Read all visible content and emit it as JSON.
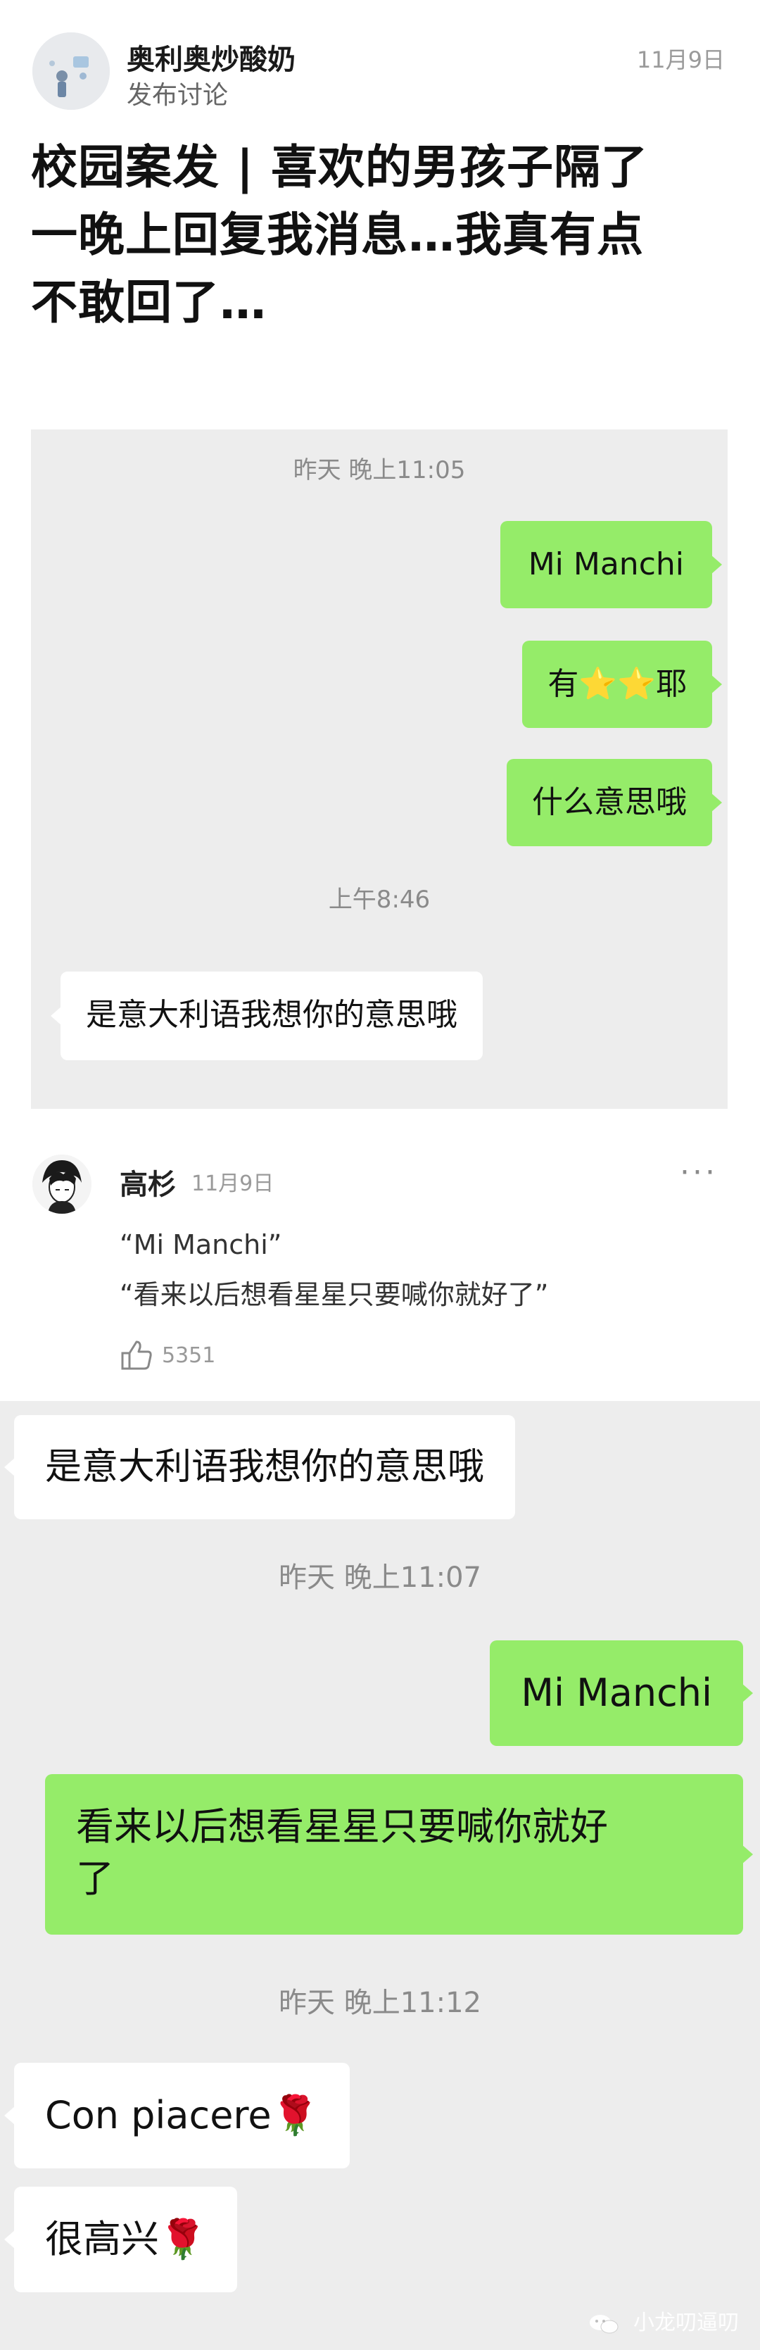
{
  "post": {
    "author": "奥利奥炒酸奶",
    "action": "发布讨论",
    "date": "11月9日",
    "title_line1": "校园案发 | 喜欢的男孩子隔了",
    "title_line2": "一晚上回复我消息…我真有点",
    "title_line3": "不敢回了…"
  },
  "chat1": {
    "ts1": "昨天 晚上11:05",
    "msg1": "Mi Manchi",
    "msg2": "有⭐⭐耶",
    "msg3": "什么意思哦",
    "ts2": "上午8:46",
    "msg4": "是意大利语我想你的意思哦"
  },
  "comment": {
    "name": "高杉",
    "date": "11月9日",
    "more": "···",
    "line1": "“Mi Manchi”",
    "line2": "“看来以后想看星星只要喊你就好了”",
    "likes": "5351"
  },
  "chat2": {
    "msg1": "是意大利语我想你的意思哦",
    "ts1": "昨天 晚上11:07",
    "msg2": "Mi Manchi",
    "msg3_line1": "看来以后想看星星只要喊你就好",
    "msg3_line2": "了",
    "ts2": "昨天 晚上11:12",
    "msg4": "Con piacere🌹",
    "msg5": "很高兴🌹"
  },
  "watermark": "小龙叨逼叨"
}
